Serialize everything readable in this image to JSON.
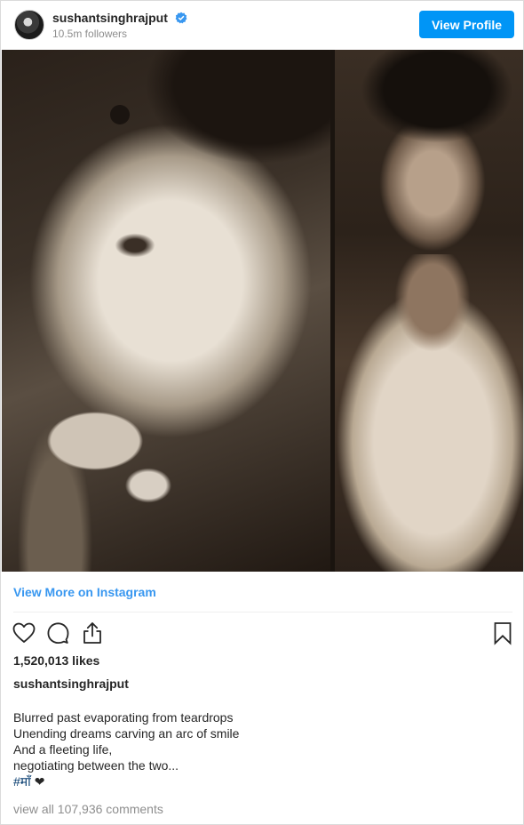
{
  "header": {
    "username": "sushantsinghrajput",
    "followers": "10.5m followers",
    "view_profile_label": "View Profile"
  },
  "post": {
    "view_more_label": "View More on Instagram",
    "likes": "1,520,013 likes",
    "caption_username": "sushantsinghrajput",
    "caption_lines": [
      "Blurred past evaporating from teardrops",
      "Unending dreams carving an arc of smile",
      "And a fleeting life,",
      "negotiating between the two..."
    ],
    "hashtag": "#माँ",
    "heart_emoji": "❤",
    "comments_label": "view all 107,936 comments"
  },
  "colors": {
    "accent": "#0095f6",
    "link": "#3897f0",
    "muted": "#8e8e8e",
    "text": "#262626"
  },
  "icons": {
    "verified": "verified-badge-icon",
    "like": "heart-icon",
    "comment": "comment-icon",
    "share": "share-icon",
    "save": "bookmark-icon"
  }
}
